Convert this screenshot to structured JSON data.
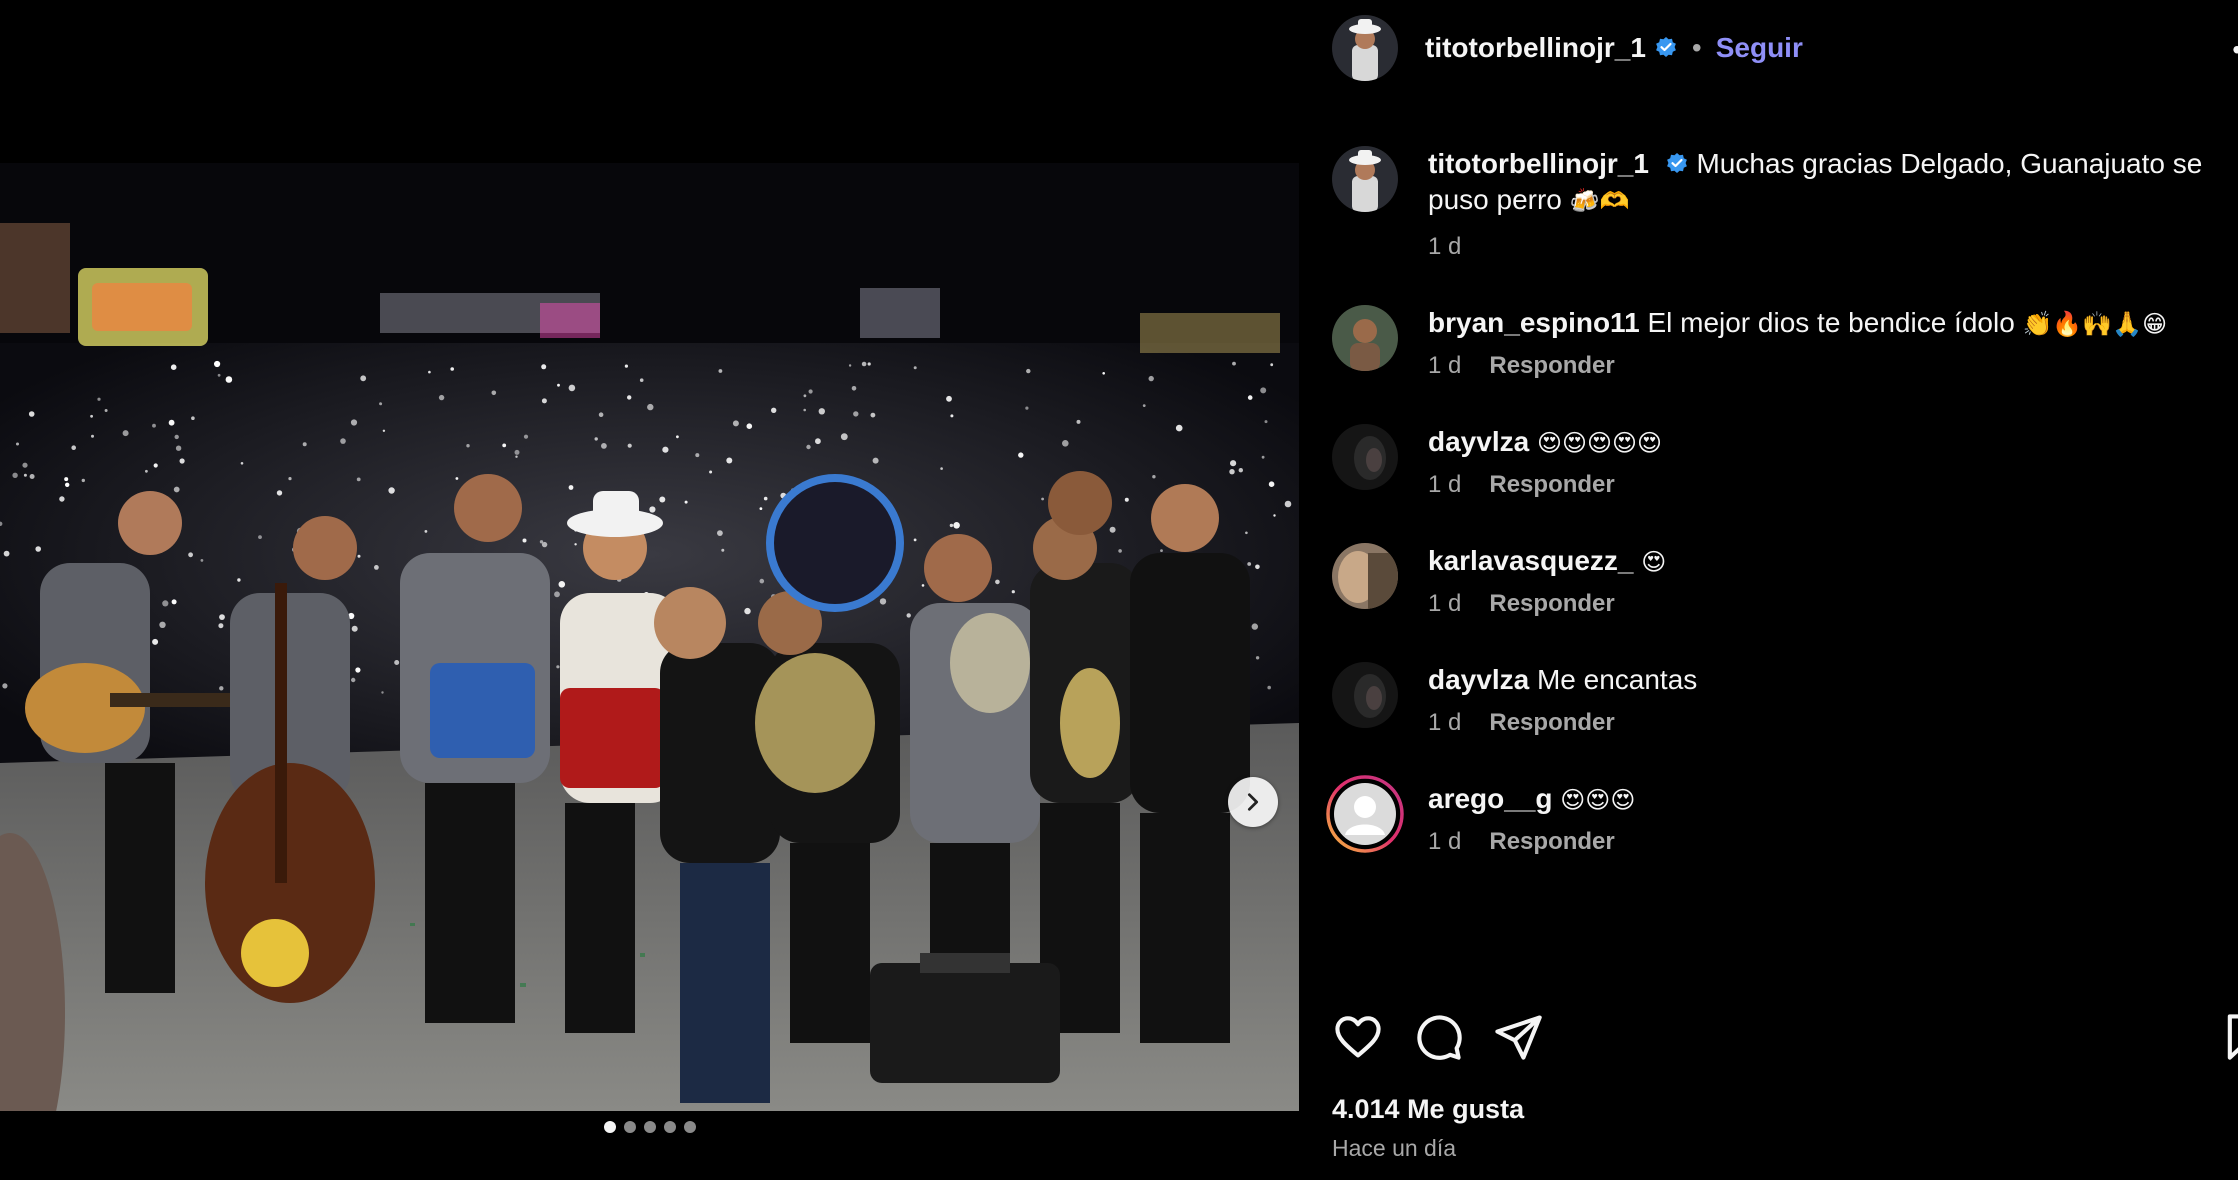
{
  "post": {
    "username": "titotorbellinojr_1",
    "verified": true,
    "separator": "•",
    "follow_label": "Seguir",
    "more_label": "•",
    "likes": "4.014 Me gusta",
    "date": "Hace un día",
    "carousel": {
      "current": 1,
      "total": 5
    }
  },
  "caption": {
    "username": "titotorbellinojr_1",
    "text": "Muchas gracias Delgado, Guanajuato se puso perro",
    "emojis": "🍻🫶",
    "time": "1 d"
  },
  "comments": [
    {
      "username": "bryan_espino11",
      "text": "El mejor dios te bendice ídolo",
      "emojis": "👏🔥🙌🙏😁",
      "time": "1 d",
      "reply": "Responder"
    },
    {
      "username": "dayvlza",
      "text": "",
      "emojis": "😍😍😍😍😍",
      "time": "1 d",
      "reply": "Responder"
    },
    {
      "username": "karlavasquezz_",
      "text": "",
      "emojis": "😍",
      "time": "1 d",
      "reply": "Responder"
    },
    {
      "username": "dayvlza",
      "text": "Me encantas",
      "emojis": "",
      "time": "1 d",
      "reply": "Responder"
    },
    {
      "username": "arego__g",
      "text": "",
      "emojis": "😍😍😍",
      "time": "1 d",
      "reply": "Responder"
    }
  ],
  "icons": {
    "like": "heart-icon",
    "comment": "comment-icon",
    "share": "send-icon",
    "save": "bookmark-icon",
    "next": "chevron-right-icon",
    "verified": "verified-badge-icon"
  },
  "colors": {
    "background": "#000000",
    "text": "#f5f5f5",
    "muted": "#a8a8a8",
    "follow": "#8f8ff7",
    "verified": "#3897f0"
  }
}
